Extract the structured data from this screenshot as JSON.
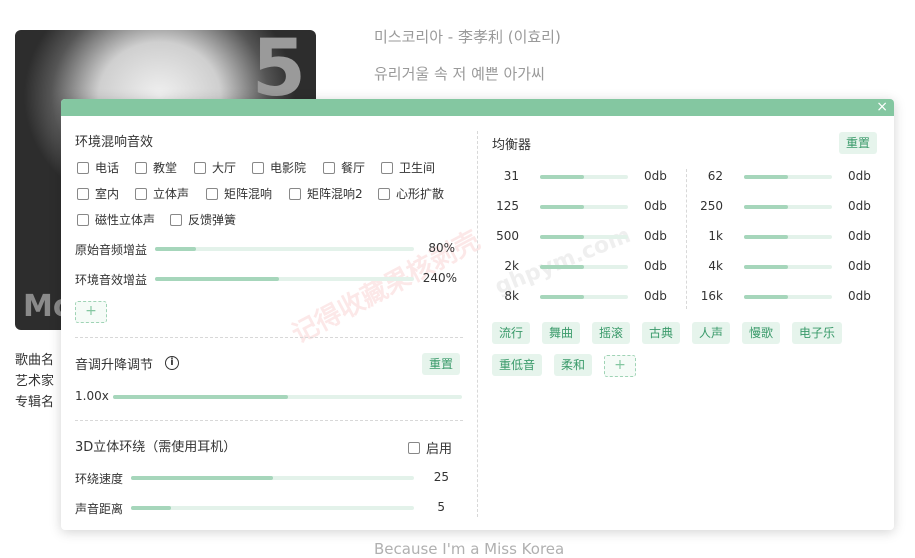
{
  "player": {
    "song_title": "미스코리아 - 李孝利 (이효리)",
    "lyric_line": "유리거울 속 저 예쁜 아가씨",
    "lyric_bottom": "Because I'm a Miss Korea",
    "album_number": "5",
    "album_text": "Mo",
    "meta_song": "歌曲名",
    "meta_artist": "艺术家",
    "meta_album": "专辑名"
  },
  "dialog": {
    "close_glyph": "×",
    "reverb": {
      "title": "环境混响音效",
      "options": [
        "电话",
        "教堂",
        "大厅",
        "电影院",
        "餐厅",
        "卫生间",
        "室内",
        "立体声",
        "矩阵混响",
        "矩阵混响2",
        "心形扩散",
        "磁性立体声",
        "反馈弹簧"
      ],
      "original_gain_label": "原始音频增益",
      "original_gain_value": "80%",
      "original_gain_fraction": 0.16,
      "env_gain_label": "环境音效增益",
      "env_gain_value": "240%",
      "env_gain_fraction": 0.48,
      "add_glyph": "+"
    },
    "pitch": {
      "title": "音调升降调节",
      "info_glyph": "i",
      "reset_label": "重置",
      "value": "1.00x",
      "fraction": 0.5
    },
    "surround": {
      "title": "3D立体环绕（需使用耳机）",
      "enable_label": "启用",
      "speed_label": "环绕速度",
      "speed_value": "25",
      "speed_fraction": 0.5,
      "distance_label": "声音距离",
      "distance_value": "5",
      "distance_fraction": 0.14
    },
    "equalizer": {
      "title": "均衡器",
      "reset_label": "重置",
      "bands_left": [
        {
          "freq": "31",
          "value": "0db",
          "fraction": 0.5
        },
        {
          "freq": "125",
          "value": "0db",
          "fraction": 0.5
        },
        {
          "freq": "500",
          "value": "0db",
          "fraction": 0.5
        },
        {
          "freq": "2k",
          "value": "0db",
          "fraction": 0.5
        },
        {
          "freq": "8k",
          "value": "0db",
          "fraction": 0.5
        }
      ],
      "bands_right": [
        {
          "freq": "62",
          "value": "0db",
          "fraction": 0.5
        },
        {
          "freq": "250",
          "value": "0db",
          "fraction": 0.5
        },
        {
          "freq": "1k",
          "value": "0db",
          "fraction": 0.5
        },
        {
          "freq": "4k",
          "value": "0db",
          "fraction": 0.5
        },
        {
          "freq": "16k",
          "value": "0db",
          "fraction": 0.5
        }
      ],
      "presets": [
        "流行",
        "舞曲",
        "摇滚",
        "古典",
        "人声",
        "慢歌",
        "电子乐",
        "重低音",
        "柔和"
      ],
      "add_glyph": "+"
    },
    "watermark": "记得收藏果核剥壳",
    "watermark2": "ghpym.com"
  },
  "colors": {
    "accent": "#84c7a1",
    "slider_fill": "#a6d6bb",
    "slider_track": "#e3f2ea",
    "button_bg": "#e6f4ec",
    "button_text": "#3a9a6a"
  }
}
